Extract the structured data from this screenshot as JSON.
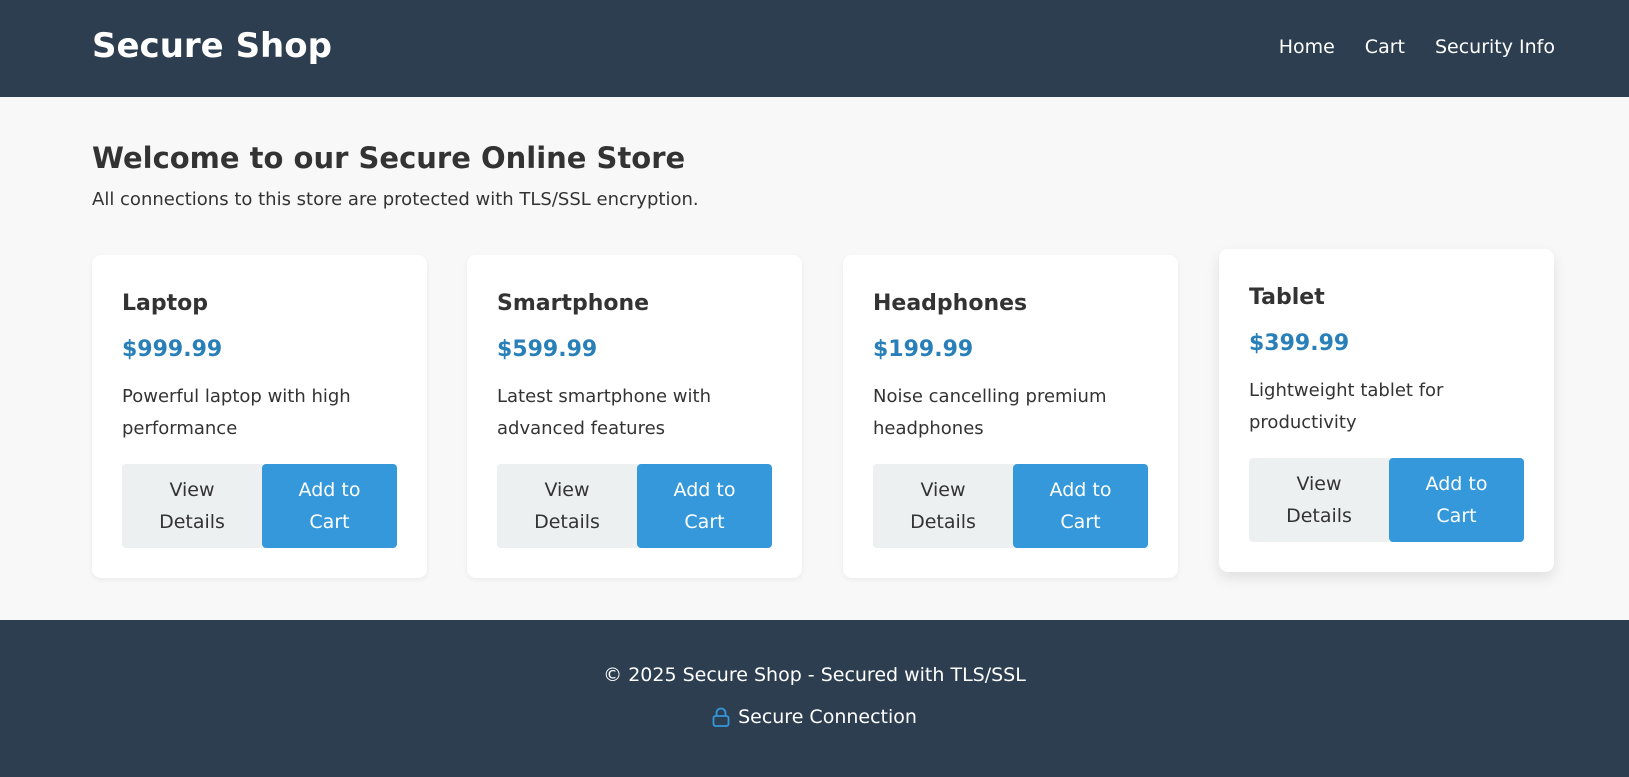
{
  "header": {
    "brand": "Secure Shop",
    "nav": [
      "Home",
      "Cart",
      "Security Info"
    ]
  },
  "main": {
    "title": "Welcome to our Secure Online Store",
    "subtitle": "All connections to this store are protected with TLS/SSL encryption."
  },
  "products": [
    {
      "name": "Laptop",
      "price": "$999.99",
      "description": "Powerful laptop with high performance",
      "view_label": "View Details",
      "add_label": "Add to Cart"
    },
    {
      "name": "Smartphone",
      "price": "$599.99",
      "description": "Latest smartphone with advanced features",
      "view_label": "View Details",
      "add_label": "Add to Cart"
    },
    {
      "name": "Headphones",
      "price": "$199.99",
      "description": "Noise cancelling premium headphones",
      "view_label": "View Details",
      "add_label": "Add to Cart"
    },
    {
      "name": "Tablet",
      "price": "$399.99",
      "description": "Lightweight tablet for productivity",
      "view_label": "View Details",
      "add_label": "Add to Cart"
    }
  ],
  "footer": {
    "copyright": "© 2025 Secure Shop - Secured with TLS/SSL",
    "secure_label": "Secure Connection",
    "icon": "lock-icon"
  },
  "colors": {
    "header_bg": "#2c3e50",
    "page_bg": "#f8f8f8",
    "price": "#2980b9",
    "primary_button": "#3498db",
    "secondary_button": "#ecf0f1",
    "lock_icon": "#3498db"
  }
}
